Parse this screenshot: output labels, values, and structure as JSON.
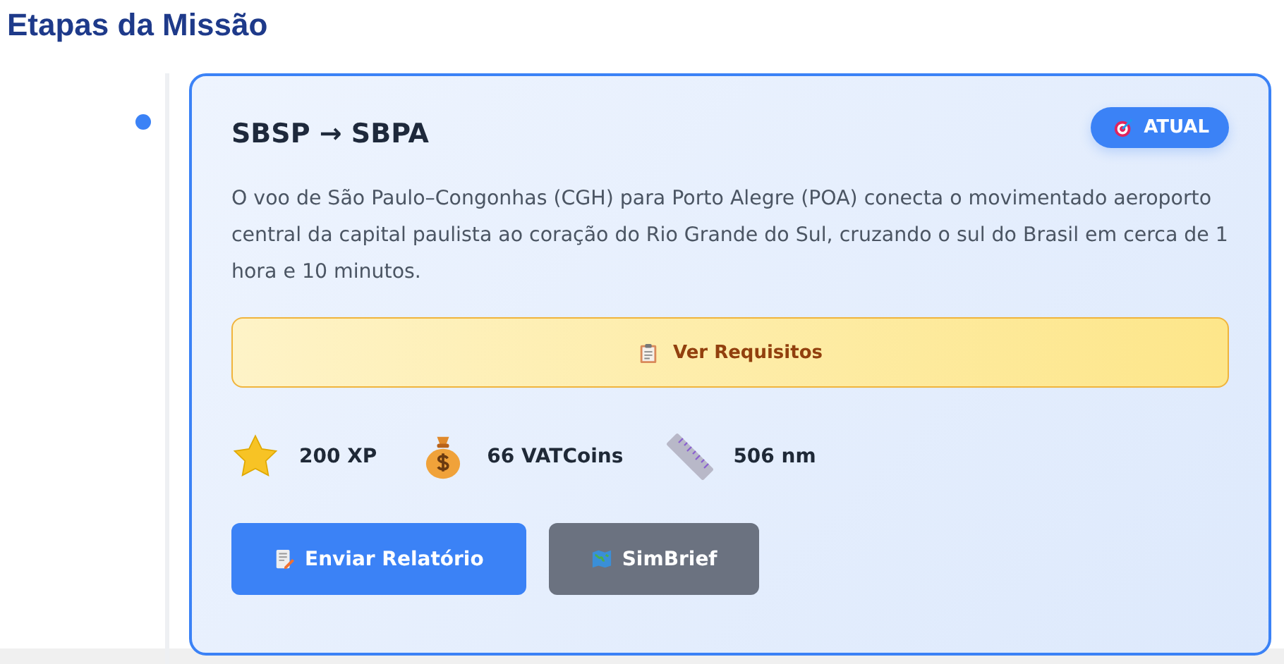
{
  "heading": "Etapas da Missão",
  "leg": {
    "route": "SBSP → SBPA",
    "status": {
      "kind": "current",
      "label": "ATUAL"
    },
    "description": "O voo de São Paulo–Congonhas (CGH) para Porto Alegre (POA) conecta o movimentado aeroporto central da capital paulista ao coração do Rio Grande do Sul, cruzando o sul do Brasil em cerca de 1 hora e 10 minutos.",
    "requirements_button": "Ver Requisitos",
    "stats": [
      {
        "kind": "xp",
        "value": "200 XP"
      },
      {
        "kind": "coins",
        "value": "66 VATCoins"
      },
      {
        "kind": "distance",
        "value": "506 nm"
      }
    ],
    "actions": [
      {
        "kind": "primary",
        "label": "Enviar Relatório"
      },
      {
        "kind": "secondary",
        "label": "SimBrief"
      }
    ]
  }
}
